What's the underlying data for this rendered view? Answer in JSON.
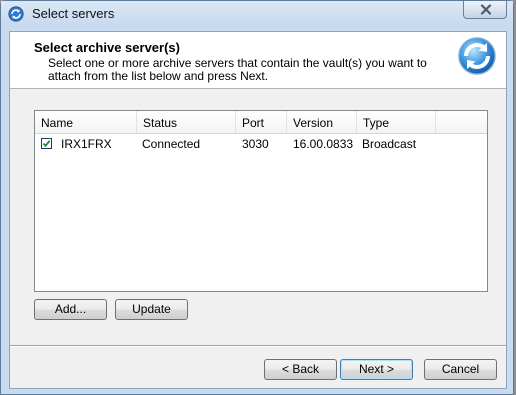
{
  "window": {
    "title": "Select servers",
    "close_icon": "close-icon",
    "app_icon": "refresh-arrows-icon"
  },
  "header": {
    "title": "Select archive server(s)",
    "description": "Select one or more archive servers that contain the vault(s) you want to attach from the list below and press Next.",
    "icon": "refresh-arrows-icon"
  },
  "server_list": {
    "columns": [
      "Name",
      "Status",
      "Port",
      "Version",
      "Type"
    ],
    "rows": [
      {
        "checked": true,
        "name": "IRX1FRX",
        "status": "Connected",
        "port": "3030",
        "version": "16.00.0833",
        "type": "Broadcast"
      }
    ]
  },
  "list_buttons": {
    "add": "Add...",
    "update": "Update"
  },
  "footer_buttons": {
    "back": "< Back",
    "next": "Next >",
    "cancel": "Cancel"
  },
  "colors": {
    "accent": "#3c7fb1",
    "title_bar": "#c9dbee"
  }
}
